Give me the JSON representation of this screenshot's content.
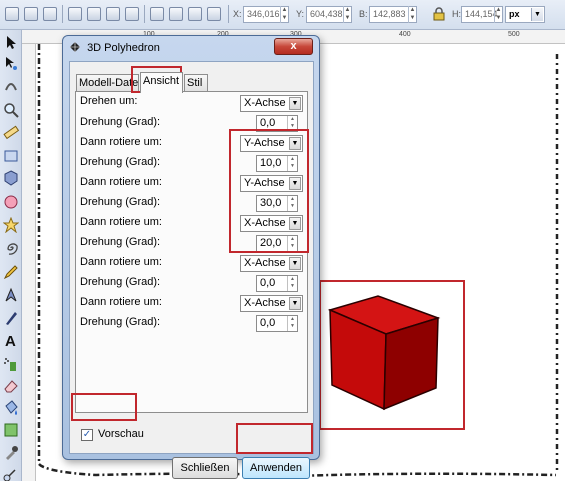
{
  "toolbar": {
    "x_label": "X:",
    "x_value": "346,016",
    "y_label": "Y:",
    "y_value": "604,438",
    "w_label": "B:",
    "w_value": "142,883",
    "h_label": "H:",
    "h_value": "144,154",
    "unit": "px",
    "icons": [
      "select-all-icon",
      "select-in-all-layers-icon",
      "deselect-icon",
      "rotate-ccw-icon",
      "rotate-cw-icon",
      "flip-horizontal-icon",
      "flip-vertical-icon",
      "raise-to-top-icon",
      "raise-icon",
      "lower-icon",
      "lower-to-bottom-icon"
    ]
  },
  "ruler": {
    "marks": [
      "100",
      "200",
      "300",
      "400",
      "500"
    ]
  },
  "dialog": {
    "title": "3D Polyhedron",
    "close_label": "x",
    "tabs": [
      {
        "label": "Modell-Daten"
      },
      {
        "label": "Ansicht"
      },
      {
        "label": "Stil"
      }
    ],
    "rows": [
      {
        "label": "Drehen um:",
        "value": "X-Achse"
      },
      {
        "label": "Drehung (Grad):",
        "value": "0,0"
      },
      {
        "label": "Dann rotiere um:",
        "value": "Y-Achse"
      },
      {
        "label": "Drehung (Grad):",
        "value": "10,0"
      },
      {
        "label": "Dann rotiere um:",
        "value": "Y-Achse"
      },
      {
        "label": "Drehung (Grad):",
        "value": "30,0"
      },
      {
        "label": "Dann rotiere um:",
        "value": "X-Achse"
      },
      {
        "label": "Drehung (Grad):",
        "value": "20,0"
      },
      {
        "label": "Dann rotiere um:",
        "value": "X-Achse"
      },
      {
        "label": "Drehung (Grad):",
        "value": "0,0"
      },
      {
        "label": "Dann rotiere um:",
        "value": "X-Achse"
      },
      {
        "label": "Drehung (Grad):",
        "value": "0,0"
      }
    ],
    "preview_label": "Vorschau",
    "preview_checked": true,
    "close_button": "Schließen",
    "apply_button": "Anwenden"
  },
  "colors": {
    "cube_front": "#c40a0a",
    "cube_top": "#d41414",
    "cube_side": "#8e0000",
    "highlight": "#c1272d"
  }
}
